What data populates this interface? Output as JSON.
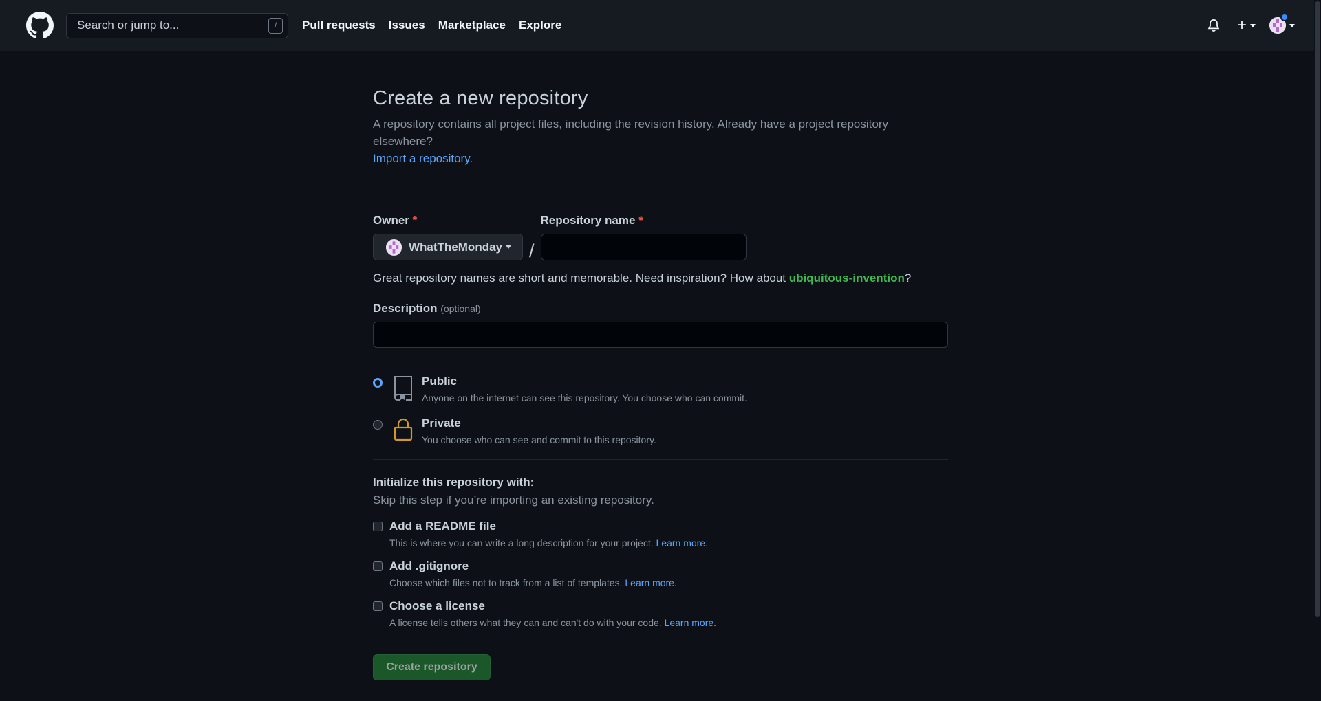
{
  "header": {
    "search_placeholder": "Search or jump to...",
    "search_shortcut": "/",
    "nav": [
      "Pull requests",
      "Issues",
      "Marketplace",
      "Explore"
    ],
    "plus_label": "+"
  },
  "page": {
    "title": "Create a new repository",
    "subtitle": "A repository contains all project files, including the revision history. Already have a project repository elsewhere?",
    "import_link": "Import a repository."
  },
  "form": {
    "owner_label": "Owner",
    "required_mark": "*",
    "owner_value": "WhatTheMonday",
    "separator": "/",
    "repo_name_label": "Repository name",
    "repo_name_value": "",
    "hint_prefix": "Great repository names are short and memorable. Need inspiration? How about ",
    "hint_suggestion": "ubiquitous-invention",
    "hint_suffix": "?",
    "description_label": "Description",
    "description_optional": "(optional)",
    "description_value": ""
  },
  "visibility": {
    "selected": "public",
    "public_title": "Public",
    "public_desc": "Anyone on the internet can see this repository. You choose who can commit.",
    "private_title": "Private",
    "private_desc": "You choose who can see and commit to this repository."
  },
  "initialize": {
    "title": "Initialize this repository with:",
    "subtitle": "Skip this step if you’re importing an existing repository.",
    "readme_title": "Add a README file",
    "readme_desc": "This is where you can write a long description for your project.",
    "gitignore_title": "Add .gitignore",
    "gitignore_desc": "Choose which files not to track from a list of templates.",
    "license_title": "Choose a license",
    "license_desc": "A license tells others what they can and can't do with your code.",
    "learn_more": "Learn more."
  },
  "submit": {
    "label": "Create repository"
  },
  "colors": {
    "background": "#0d1117",
    "header": "#161b22",
    "link": "#58a6ff",
    "suggestion": "#3fb950",
    "required": "#f85149",
    "button": "#238636",
    "lock": "#d29922"
  }
}
